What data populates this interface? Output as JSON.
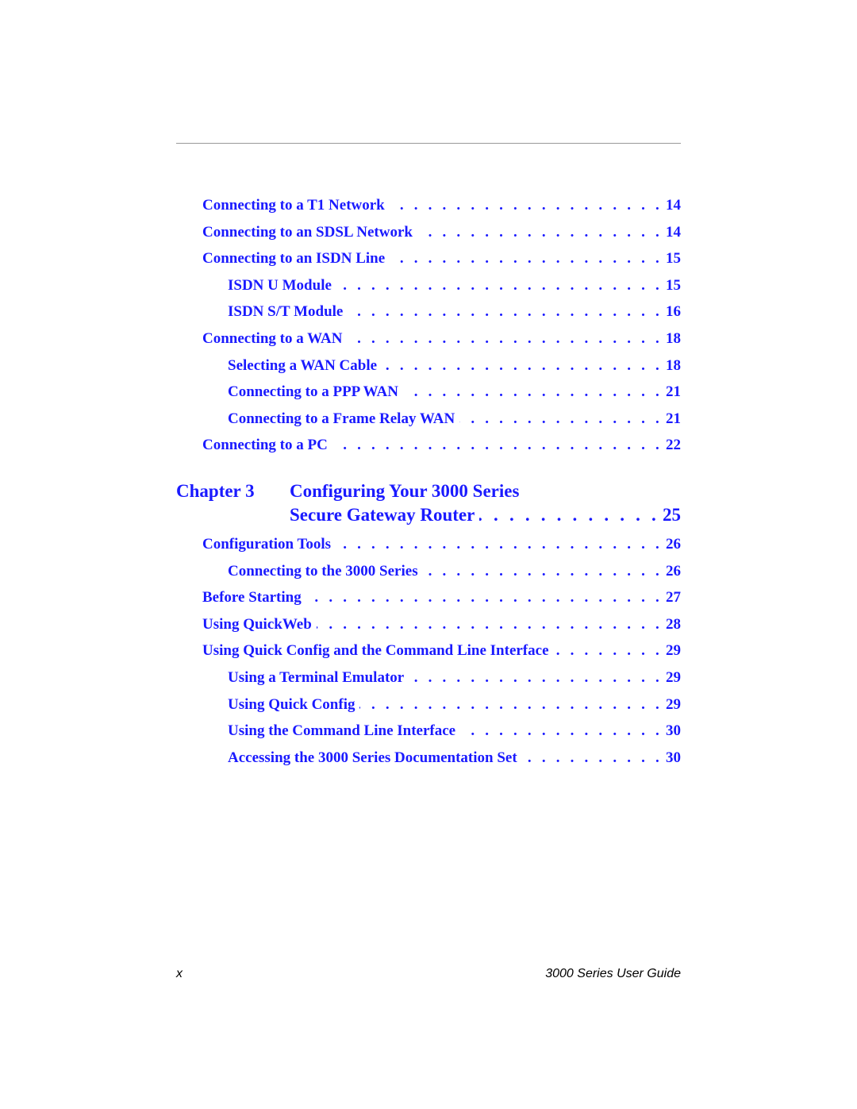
{
  "entries_top": [
    {
      "title": "Connecting to a T1 Network",
      "page": "14",
      "level": 1
    },
    {
      "title": "Connecting to an SDSL Network",
      "page": "14",
      "level": 1
    },
    {
      "title": "Connecting to an ISDN Line",
      "page": "15",
      "level": 1
    },
    {
      "title": "ISDN U Module",
      "page": "15",
      "level": 2
    },
    {
      "title": "ISDN S/T Module",
      "page": "16",
      "level": 2
    },
    {
      "title": "Connecting to a WAN",
      "page": "18",
      "level": 1
    },
    {
      "title": "Selecting a WAN Cable",
      "page": "18",
      "level": 2
    },
    {
      "title": "Connecting to a PPP WAN",
      "page": "21",
      "level": 2
    },
    {
      "title": "Connecting to a Frame Relay WAN",
      "page": "21",
      "level": 2
    },
    {
      "title": "Connecting to a PC",
      "page": "22",
      "level": 1
    }
  ],
  "chapter": {
    "label": "Chapter 3",
    "title_line1": "Configuring Your 3000 Series",
    "title_line2": "Secure Gateway Router",
    "page": "25"
  },
  "entries_bottom": [
    {
      "title": "Configuration Tools",
      "page": "26",
      "level": 1
    },
    {
      "title": "Connecting to the 3000 Series",
      "page": "26",
      "level": 2
    },
    {
      "title": "Before Starting",
      "page": "27",
      "level": 1
    },
    {
      "title": "Using QuickWeb",
      "page": "28",
      "level": 1
    },
    {
      "title": "Using Quick Config and the Command Line Interface",
      "page": "29",
      "level": 1
    },
    {
      "title": "Using a Terminal Emulator",
      "page": "29",
      "level": 2
    },
    {
      "title": "Using Quick Config",
      "page": "29",
      "level": 2
    },
    {
      "title": "Using the Command Line Interface",
      "page": "30",
      "level": 2
    },
    {
      "title": "Accessing the 3000 Series Documentation Set",
      "page": "30",
      "level": 2
    }
  ],
  "footer": {
    "page_number": "x",
    "book_title": "3000 Series User Guide"
  },
  "colors": {
    "link": "#1a1aff",
    "rule": "#999999"
  }
}
